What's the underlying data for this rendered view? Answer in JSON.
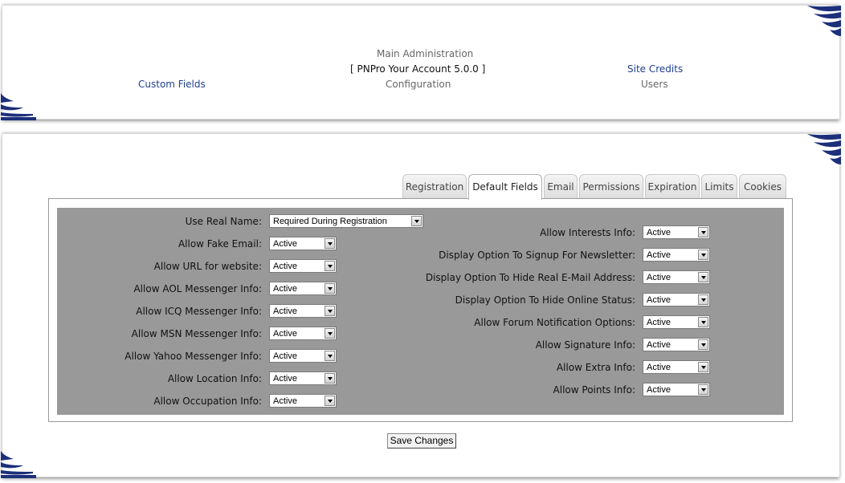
{
  "nav": {
    "main_admin": "Main Administration",
    "version": "[ PNPro Your Account 5.0.0 ]",
    "configuration": "Configuration",
    "site_credits": "Site Credits",
    "users": "Users",
    "custom_fields": "Custom Fields"
  },
  "tabs": [
    {
      "label": "Registration"
    },
    {
      "label": "Default Fields"
    },
    {
      "label": "Email"
    },
    {
      "label": "Permissions"
    },
    {
      "label": "Expiration"
    },
    {
      "label": "Limits"
    },
    {
      "label": "Cookies"
    }
  ],
  "active_tab": "Default Fields",
  "form": {
    "left": [
      {
        "label": "Use Real Name:",
        "value": "Required During Registration"
      },
      {
        "label": "Allow Fake Email:",
        "value": "Active"
      },
      {
        "label": "Allow URL for website:",
        "value": "Active"
      },
      {
        "label": "Allow AOL Messenger Info:",
        "value": "Active"
      },
      {
        "label": "Allow ICQ Messenger Info:",
        "value": "Active"
      },
      {
        "label": "Allow MSN Messenger Info:",
        "value": "Active"
      },
      {
        "label": "Allow Yahoo Messenger Info:",
        "value": "Active"
      },
      {
        "label": "Allow Location Info:",
        "value": "Active"
      },
      {
        "label": "Allow Occupation Info:",
        "value": "Active"
      }
    ],
    "right": [
      {
        "label": "Allow Interests Info:",
        "value": "Active"
      },
      {
        "label": "Display Option To Signup For Newsletter:",
        "value": "Active"
      },
      {
        "label": "Display Option To Hide Real E-Mail Address:",
        "value": "Active"
      },
      {
        "label": "Display Option To Hide Online Status:",
        "value": "Active"
      },
      {
        "label": "Allow Forum Notification Options:",
        "value": "Active"
      },
      {
        "label": "Allow Signature Info:",
        "value": "Active"
      },
      {
        "label": "Allow Extra Info:",
        "value": "Active"
      },
      {
        "label": "Allow Points Info:",
        "value": "Active"
      }
    ]
  },
  "save_label": "Save Changes",
  "colors": {
    "link": "#1f3f8f",
    "form_background": "#999999",
    "swoosh": "#1c2f7a"
  }
}
